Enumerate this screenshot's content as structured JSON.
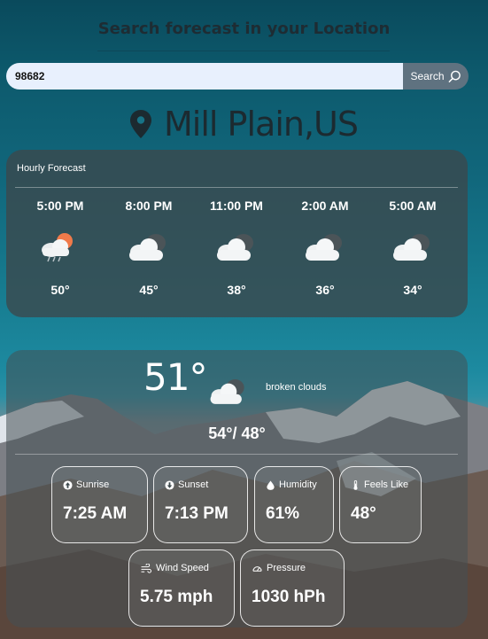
{
  "header": {
    "title": "Search forecast in your Location"
  },
  "search": {
    "value": "98682",
    "button_label": "Search"
  },
  "location": {
    "name": "Mill Plain,US"
  },
  "hourly": {
    "title": "Hourly Forecast",
    "items": [
      {
        "time": "5:00 PM",
        "temp": "50°",
        "icon": "sun-cloud-rain-icon"
      },
      {
        "time": "8:00 PM",
        "temp": "45°",
        "icon": "broken-clouds-icon"
      },
      {
        "time": "11:00 PM",
        "temp": "38°",
        "icon": "broken-clouds-icon"
      },
      {
        "time": "2:00 AM",
        "temp": "36°",
        "icon": "broken-clouds-icon"
      },
      {
        "time": "5:00 AM",
        "temp": "34°",
        "icon": "broken-clouds-icon"
      }
    ]
  },
  "current": {
    "temp": "51°",
    "description": "broken clouds",
    "range": "54°/ 48°",
    "icon": "broken-clouds-icon"
  },
  "stats": {
    "sunrise": {
      "label": "Sunrise",
      "value": "7:25 AM",
      "icon": "arrow-up-circle-icon"
    },
    "sunset": {
      "label": "Sunset",
      "value": "7:13 PM",
      "icon": "arrow-down-circle-icon"
    },
    "humidity": {
      "label": "Humidity",
      "value": "61%",
      "icon": "droplet-icon"
    },
    "feels_like": {
      "label": "Feels Like",
      "value": "48°",
      "icon": "thermometer-icon"
    },
    "wind_speed": {
      "label": "Wind Speed",
      "value": "5.75 mph",
      "icon": "wind-icon"
    },
    "pressure": {
      "label": "Pressure",
      "value": "1030 hPh",
      "icon": "gauge-icon"
    }
  },
  "colors": {
    "search_button": "#5f7280",
    "search_input": "#e8f0fd",
    "card": "#3c484c",
    "sun": "#f07a4a"
  }
}
